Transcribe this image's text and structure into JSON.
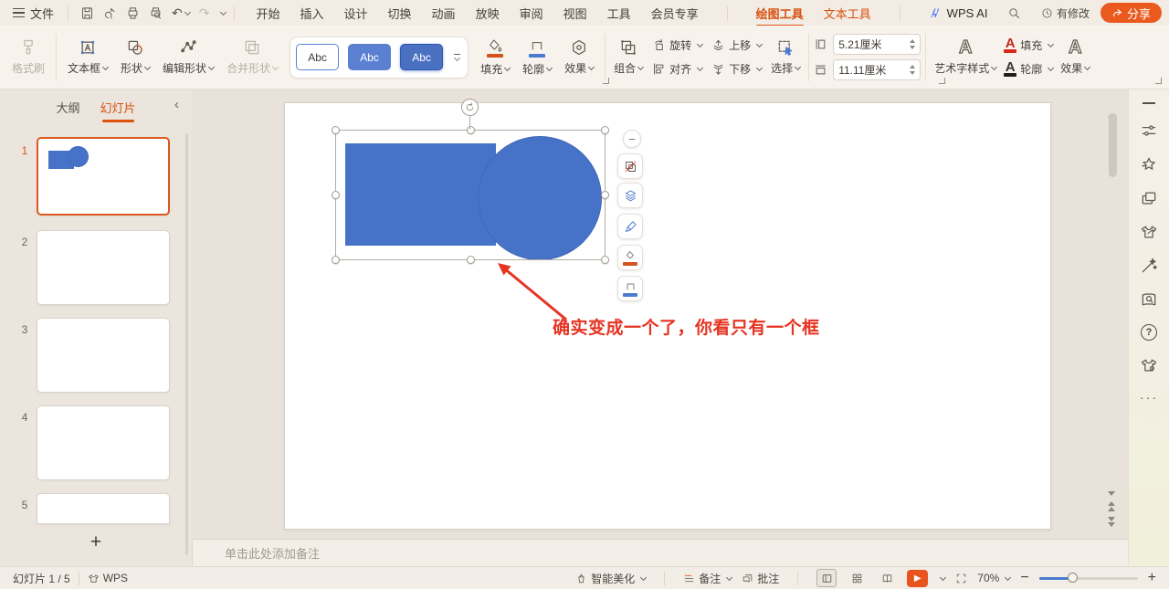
{
  "titlebar": {
    "file_label": "文件",
    "tabs": [
      "开始",
      "插入",
      "设计",
      "切换",
      "动画",
      "放映",
      "审阅",
      "视图",
      "工具",
      "会员专享"
    ],
    "context_tabs": [
      {
        "label": "绘图工具",
        "active": true
      },
      {
        "label": "文本工具",
        "active": false
      }
    ],
    "wps_ai_label": "WPS AI",
    "modified_label": "有修改",
    "share_label": "分享"
  },
  "ribbon": {
    "format_painter_label": "格式刷",
    "insert": {
      "textbox_label": "文本框",
      "shapes_label": "形状",
      "edit_shape_label": "编辑形状",
      "merge_shapes_label": "合并形状"
    },
    "style_gallery": {
      "items": [
        "Abc",
        "Abc",
        "Abc"
      ],
      "selected_index": 2
    },
    "shape_format": {
      "fill_label": "填充",
      "outline_label": "轮廓",
      "effects_label": "效果"
    },
    "arrange": {
      "group_label": "组合",
      "rotate_label": "旋转",
      "align_label": "对齐",
      "up_label": "上移",
      "down_label": "下移",
      "select_label": "选择"
    },
    "size": {
      "height_value": "5.21厘米",
      "width_value": "11.11厘米"
    },
    "wordart": {
      "styles_label": "艺术字样式",
      "fill_label": "填充",
      "outline_label": "轮廓",
      "effects_label": "效果"
    }
  },
  "slide_panel": {
    "tabs": [
      {
        "label": "大纲",
        "active": false
      },
      {
        "label": "幻灯片",
        "active": true
      }
    ],
    "collapse_glyph": "‹",
    "slides": [
      {
        "number": "1",
        "selected": true
      },
      {
        "number": "2",
        "selected": false
      },
      {
        "number": "3",
        "selected": false
      },
      {
        "number": "4",
        "selected": false
      },
      {
        "number": "5",
        "selected": false
      }
    ],
    "add_label": "+"
  },
  "canvas": {
    "annotation_text": "确实变成一个了，你看只有一个框",
    "shape_color": "#4673c8",
    "annotation_color": "#e63322"
  },
  "notes": {
    "placeholder": "单击此处添加备注"
  },
  "statusbar": {
    "slide_counter": "幻灯片 1 / 5",
    "wps_label": "WPS",
    "beautify_label": "智能美化",
    "notes_label": "备注",
    "comments_label": "批注",
    "zoom_value": "70%"
  },
  "glyphs": {
    "undo": "↶",
    "redo": "↷",
    "minus": "−",
    "play": "▶",
    "question": "?",
    "more": "···",
    "abc": "Abc"
  },
  "colors": {
    "accent_orange": "#e0530f",
    "share_orange": "#ea5a1f",
    "shape_blue": "#4673c8",
    "annotation_red": "#e63322"
  }
}
